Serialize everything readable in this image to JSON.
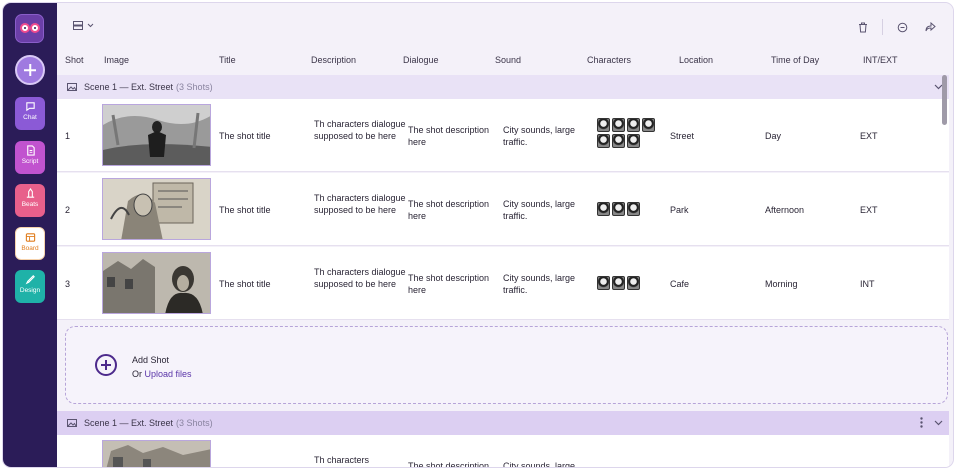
{
  "sidebar": {
    "nav": [
      {
        "label": "Chat",
        "icon": "chat-icon"
      },
      {
        "label": "Script",
        "icon": "script-icon"
      },
      {
        "label": "Beats",
        "icon": "beats-icon"
      },
      {
        "label": "Board",
        "icon": "board-icon"
      },
      {
        "label": "Design",
        "icon": "design-icon"
      }
    ]
  },
  "columns": [
    "Shot",
    "Image",
    "Title",
    "Description",
    "Dialogue",
    "Sound",
    "Characters",
    "Location",
    "Time of Day",
    "INT/EXT"
  ],
  "scenes": [
    {
      "title": "Scene 1 — Ext. Street",
      "count": "(3 Shots)",
      "shots": [
        {
          "num": "1",
          "title": "The shot title",
          "description": "Th characters dialogue supposed to be here",
          "dialogue": "The shot description here",
          "sound": "City sounds, large traffic.",
          "location": "Street",
          "time": "Day",
          "intext": "EXT"
        },
        {
          "num": "2",
          "title": "The shot title",
          "description": "Th characters dialogue supposed to be here",
          "dialogue": "The shot description here",
          "sound": "City sounds, large traffic.",
          "location": "Park",
          "time": "Afternoon",
          "intext": "EXT"
        },
        {
          "num": "3",
          "title": "The shot title",
          "description": "Th characters dialogue supposed to be here",
          "dialogue": "The shot description here",
          "sound": "City sounds, large traffic.",
          "location": "Cafe",
          "time": "Morning",
          "intext": "INT"
        }
      ]
    },
    {
      "title": "Scene 1 — Ext. Street",
      "count": "(3 Shots)",
      "shots": [
        {
          "description": "Th characters",
          "dialogue": "The shot description",
          "sound": "City sounds, large"
        }
      ]
    }
  ],
  "add_shot": {
    "label": "Add Shot",
    "or": "Or",
    "upload": "Upload files"
  },
  "colors": {
    "sidebar": "#2b1c58",
    "accent": "#5a35a8",
    "scene_header": "#e9e2f6"
  }
}
